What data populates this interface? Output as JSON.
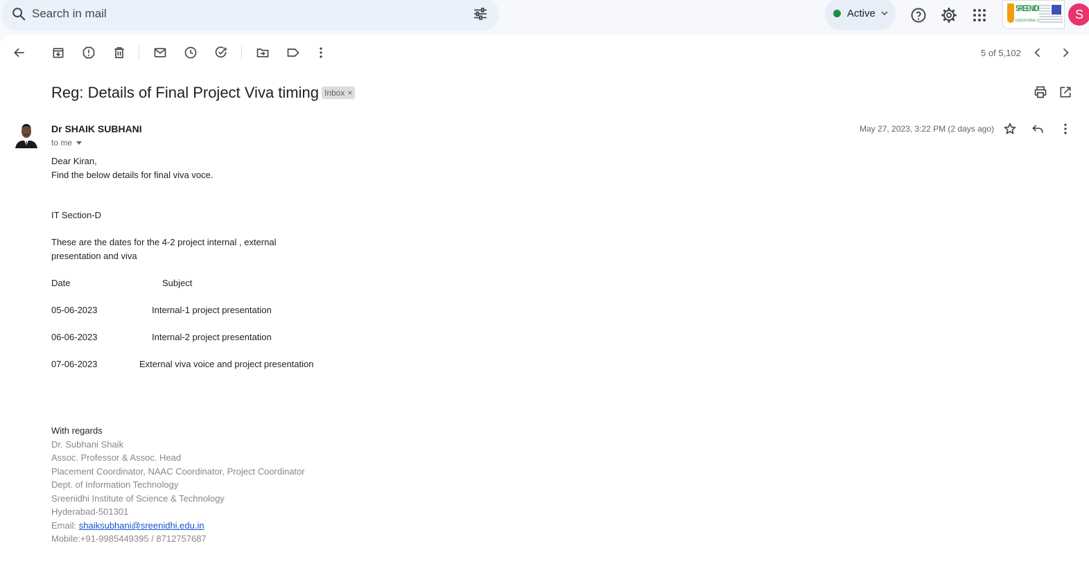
{
  "search": {
    "placeholder": "Search in mail"
  },
  "status": {
    "label": "Active",
    "color": "#1e8e3e"
  },
  "header_icons": [
    "help-icon",
    "settings-icon",
    "apps-icon"
  ],
  "brand": {
    "name": "SREENIDHI",
    "sub": "EDUCATIONAL GROUP"
  },
  "account": {
    "initial": "S"
  },
  "toolbar": {
    "buttons": [
      "back",
      "archive",
      "report-spam",
      "delete",
      "mark-unread",
      "snooze",
      "add-to-tasks",
      "move-to",
      "labels",
      "more"
    ],
    "counter": "5 of 5,102"
  },
  "email": {
    "subject": "Reg: Details of Final Project Viva timing",
    "label_chip": "Inbox",
    "chip_close": "×",
    "sender": "Dr SHAIK SUBHANI",
    "to": "to me",
    "date": "May 27, 2023, 3:22 PM (2 days ago)",
    "body": {
      "greeting": "Dear Kiran,",
      "intro": "Find the below details for final viva voce.",
      "section": "IT Section-D",
      "desc1": "These are the dates for the 4-2 project internal , external",
      "desc2": "presentation and viva",
      "table_header": {
        "date": "Date",
        "subject": "Subject"
      },
      "rows": [
        {
          "date": "05-06-2023",
          "subject": "Internal-1 project presentation"
        },
        {
          "date": "06-06-2023",
          "subject": "Internal-2 project presentation"
        },
        {
          "date": "07-06-2023",
          "subject": "External viva voice and project presentation"
        }
      ],
      "closing": "With regards"
    },
    "signature": {
      "name": "Dr. Subhani Shaik",
      "title": "Assoc. Professor & Assoc. Head",
      "roles": "Placement Coordinator, NAAC Coordinator, Project Coordinator",
      "dept": "Dept. of Information Technology",
      "institute": "Sreenidhi Institute of Science & Technology",
      "city": "Hyderabad-501301",
      "email_label": "Email: ",
      "email": "shaiksubhani@sreenidhi.edu.in",
      "mobile": "Mobile:+91-9985449395 / 8712757687"
    }
  }
}
